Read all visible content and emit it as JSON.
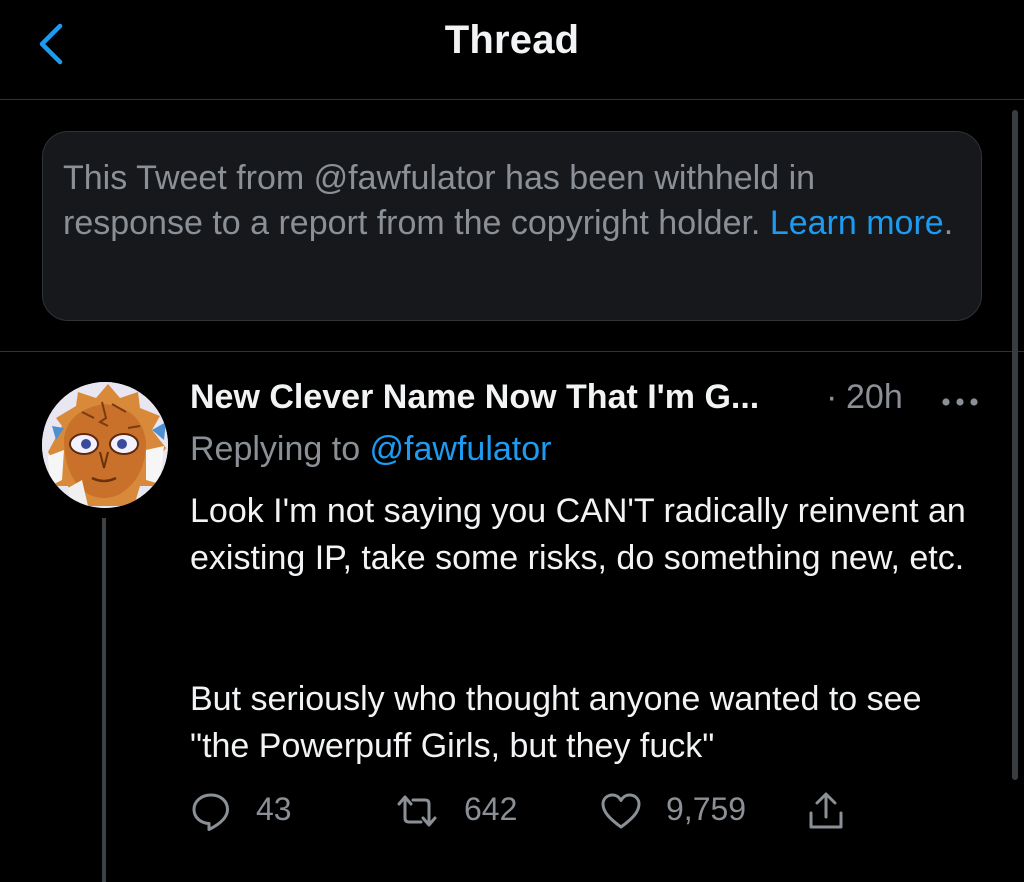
{
  "header": {
    "title": "Thread",
    "back_icon": "chevron-left-icon"
  },
  "notice": {
    "text": "This Tweet from @fawfulator has been withheld in response to a report from the copyright holder. ",
    "learn_more": "Learn more",
    "period": "."
  },
  "tweet": {
    "display_name": "New Clever Name Now That I'm G...",
    "separator": "·",
    "time": "20h",
    "replying_prefix": "Replying to ",
    "replying_handle": "@fawfulator",
    "paragraph1": "Look I'm not saying you CAN'T radically reinvent an existing IP, take some risks, do something new, etc.",
    "paragraph2": "But seriously who thought anyone wanted to see \"the Powerpuff Girls, but they fuck\"",
    "actions": {
      "replies": "43",
      "retweets": "642",
      "likes": "9,759"
    }
  },
  "colors": {
    "background": "#000000",
    "card": "#16181c",
    "accent": "#1d9bf0",
    "muted_text": "#8b9096",
    "primary_text": "#f1f3f5"
  },
  "icons": [
    "chevron-left-icon",
    "more-horizontal-icon",
    "reply-icon",
    "retweet-icon",
    "heart-icon",
    "share-icon"
  ]
}
